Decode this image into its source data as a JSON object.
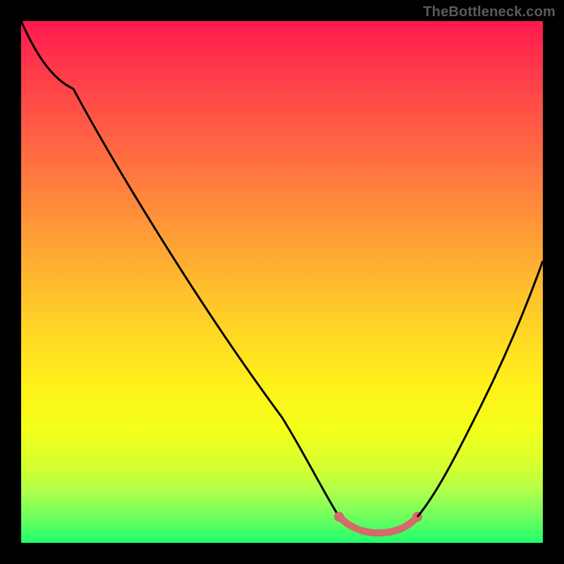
{
  "watermark": "TheBottleneck.com",
  "colors": {
    "frame": "#000000",
    "curve": "#000000",
    "flat_segment": "#d46a6a",
    "gradient_stops": [
      "#ff1a4d",
      "#ff3b4a",
      "#ff5a45",
      "#ff7a3f",
      "#ff9a37",
      "#ffba2e",
      "#ffd824",
      "#fff11a",
      "#f4ff1a",
      "#d8ff2f",
      "#b0ff4a",
      "#70ff5e",
      "#1eff6b"
    ]
  },
  "chart_data": {
    "type": "line",
    "title": "",
    "xlabel": "",
    "ylabel": "",
    "xlim": [
      0,
      100
    ],
    "ylim": [
      0,
      100
    ],
    "grid": false,
    "legend": false,
    "note": "No axis ticks or numeric labels are rendered; values are read as percentages of the plot area (x left→right, y bottom→top).",
    "series": [
      {
        "name": "left-branch",
        "x": [
          0,
          4,
          10,
          20,
          30,
          40,
          50,
          58,
          61
        ],
        "values": [
          100,
          96,
          87,
          72,
          56,
          40,
          24,
          10,
          5
        ]
      },
      {
        "name": "flat-basin",
        "x": [
          61,
          66,
          72,
          76
        ],
        "values": [
          5,
          2,
          2,
          5
        ],
        "style": "thick",
        "color": "#d46a6a"
      },
      {
        "name": "right-branch",
        "x": [
          76,
          82,
          88,
          94,
          100
        ],
        "values": [
          5,
          14,
          26,
          40,
          54
        ]
      }
    ]
  }
}
